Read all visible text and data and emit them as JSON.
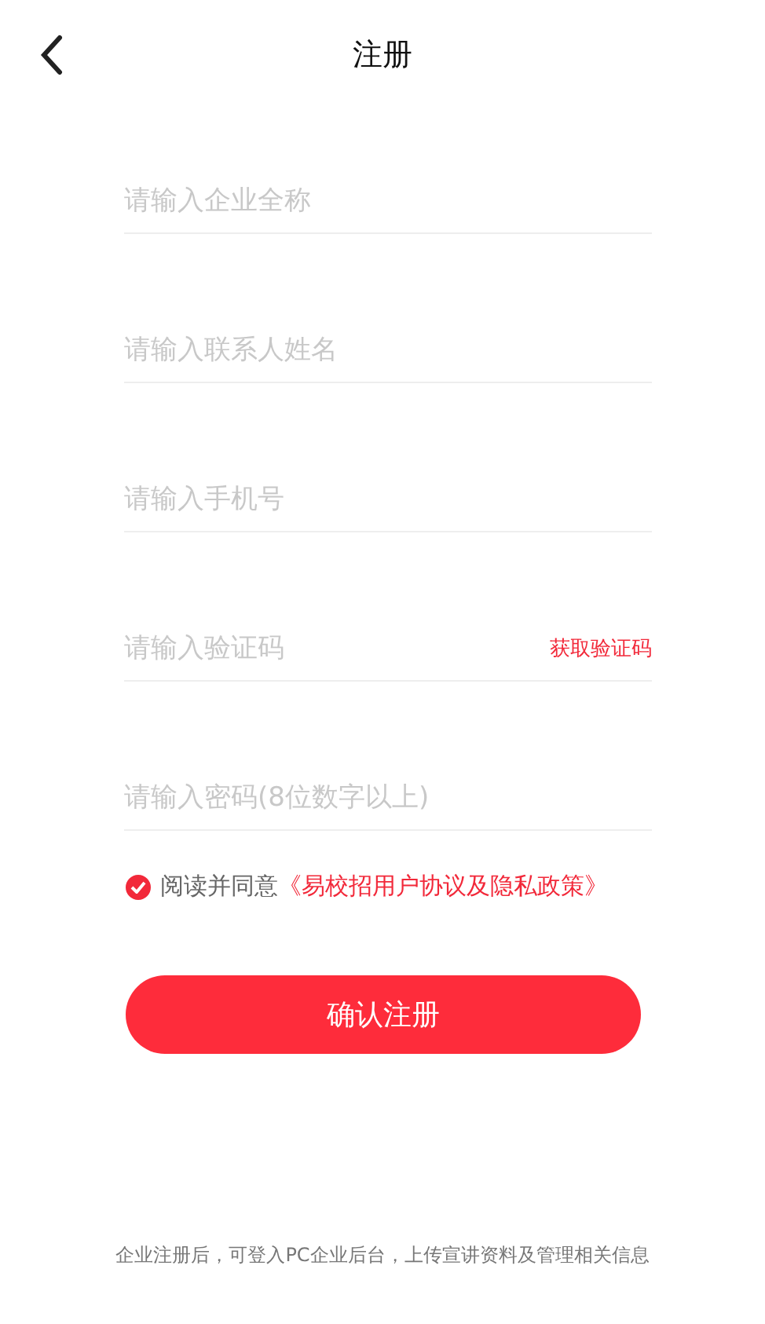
{
  "header": {
    "title": "注册"
  },
  "fields": [
    {
      "kind": "plain",
      "placeholder": "请输入企业全称"
    },
    {
      "kind": "plain",
      "placeholder": "请输入联系人姓名"
    },
    {
      "kind": "plain",
      "placeholder": "请输入手机号"
    },
    {
      "kind": "code",
      "placeholder": "请输入验证码",
      "action": "获取验证码"
    },
    {
      "kind": "plain",
      "placeholder": "请输入密码(8位数字以上)"
    }
  ],
  "agreement": {
    "checked": true,
    "text": "阅读并同意",
    "link": "《易校招用户协议及隐私政策》"
  },
  "submit": "确认注册",
  "footer_note": "企业注册后，可登入PC企业后台，上传宣讲资料及管理相关信息"
}
